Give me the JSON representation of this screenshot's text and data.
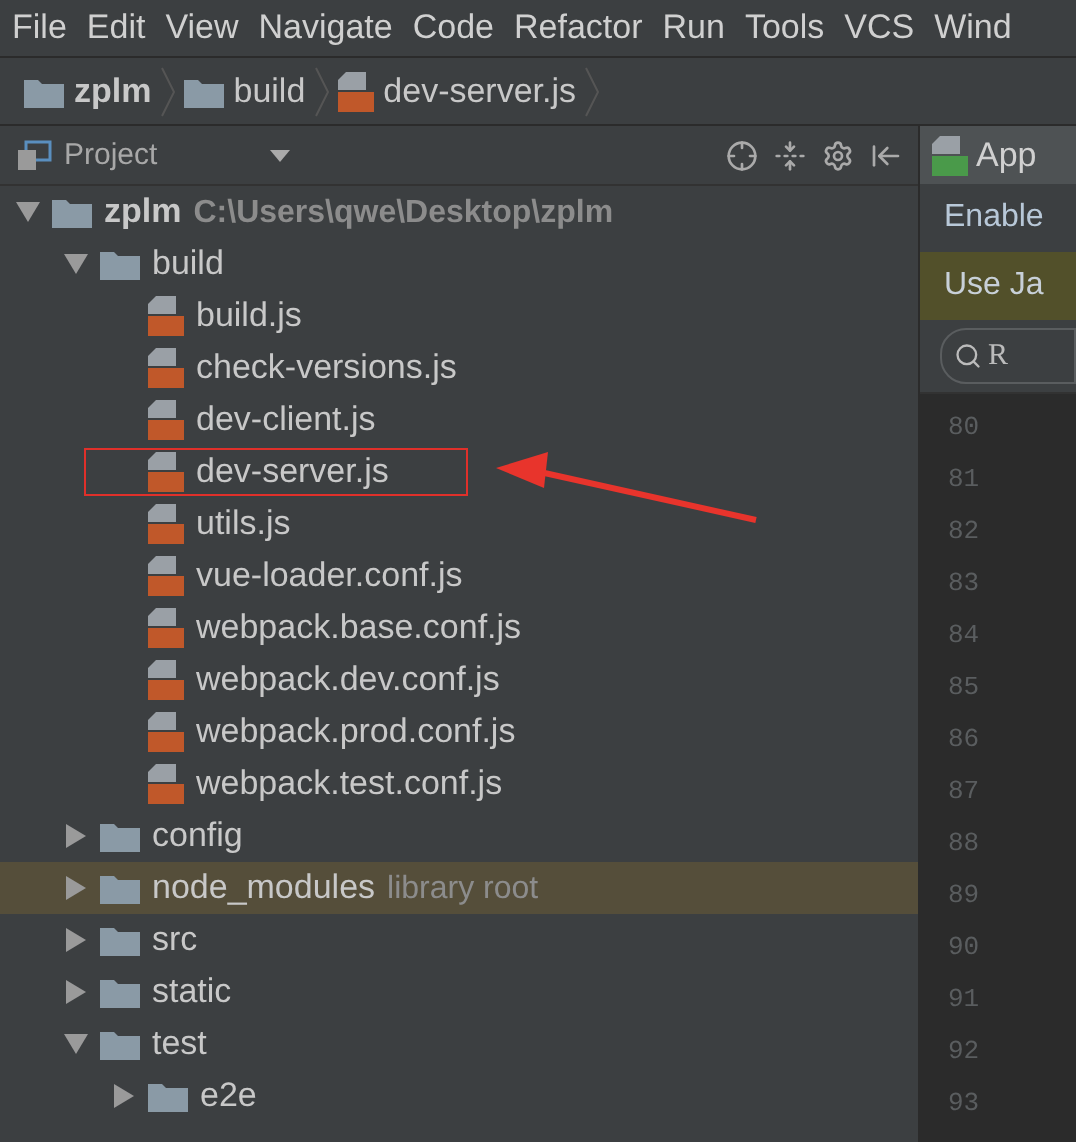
{
  "menu": [
    "File",
    "Edit",
    "View",
    "Navigate",
    "Code",
    "Refactor",
    "Run",
    "Tools",
    "VCS",
    "Wind"
  ],
  "breadcrumb": [
    {
      "label": "zplm",
      "kind": "folder"
    },
    {
      "label": "build",
      "kind": "folder"
    },
    {
      "label": "dev-server.js",
      "kind": "js"
    }
  ],
  "project_panel": {
    "title": "Project"
  },
  "tree": [
    {
      "label": "zplm",
      "kind": "folder",
      "expanded": true,
      "note": "C:\\Users\\qwe\\Desktop\\zplm",
      "children": [
        {
          "label": "build",
          "kind": "folder",
          "expanded": true,
          "selected": false,
          "children": [
            {
              "label": "build.js",
              "kind": "js"
            },
            {
              "label": "check-versions.js",
              "kind": "js"
            },
            {
              "label": "dev-client.js",
              "kind": "js"
            },
            {
              "label": "dev-server.js",
              "kind": "js",
              "annotated": true
            },
            {
              "label": "utils.js",
              "kind": "js"
            },
            {
              "label": "vue-loader.conf.js",
              "kind": "js"
            },
            {
              "label": "webpack.base.conf.js",
              "kind": "js"
            },
            {
              "label": "webpack.dev.conf.js",
              "kind": "js"
            },
            {
              "label": "webpack.prod.conf.js",
              "kind": "js"
            },
            {
              "label": "webpack.test.conf.js",
              "kind": "js"
            }
          ]
        },
        {
          "label": "config",
          "kind": "folder",
          "expanded": false,
          "selected": false
        },
        {
          "label": "node_modules",
          "kind": "folder",
          "expanded": false,
          "selected": true,
          "note": "library root"
        },
        {
          "label": "src",
          "kind": "folder",
          "expanded": false,
          "selected": false
        },
        {
          "label": "static",
          "kind": "folder",
          "expanded": false,
          "selected": false
        },
        {
          "label": "test",
          "kind": "folder",
          "expanded": true,
          "selected": false,
          "children": [
            {
              "label": "e2e",
              "kind": "folder",
              "expanded": false
            }
          ]
        }
      ]
    }
  ],
  "editor": {
    "tab": "App",
    "notice": "Enable",
    "banner": "Use Ja",
    "search": "R",
    "line_numbers": [
      "80",
      "81",
      "82",
      "83",
      "84",
      "85",
      "86",
      "87",
      "88",
      "89",
      "90",
      "91",
      "92",
      "93"
    ]
  }
}
